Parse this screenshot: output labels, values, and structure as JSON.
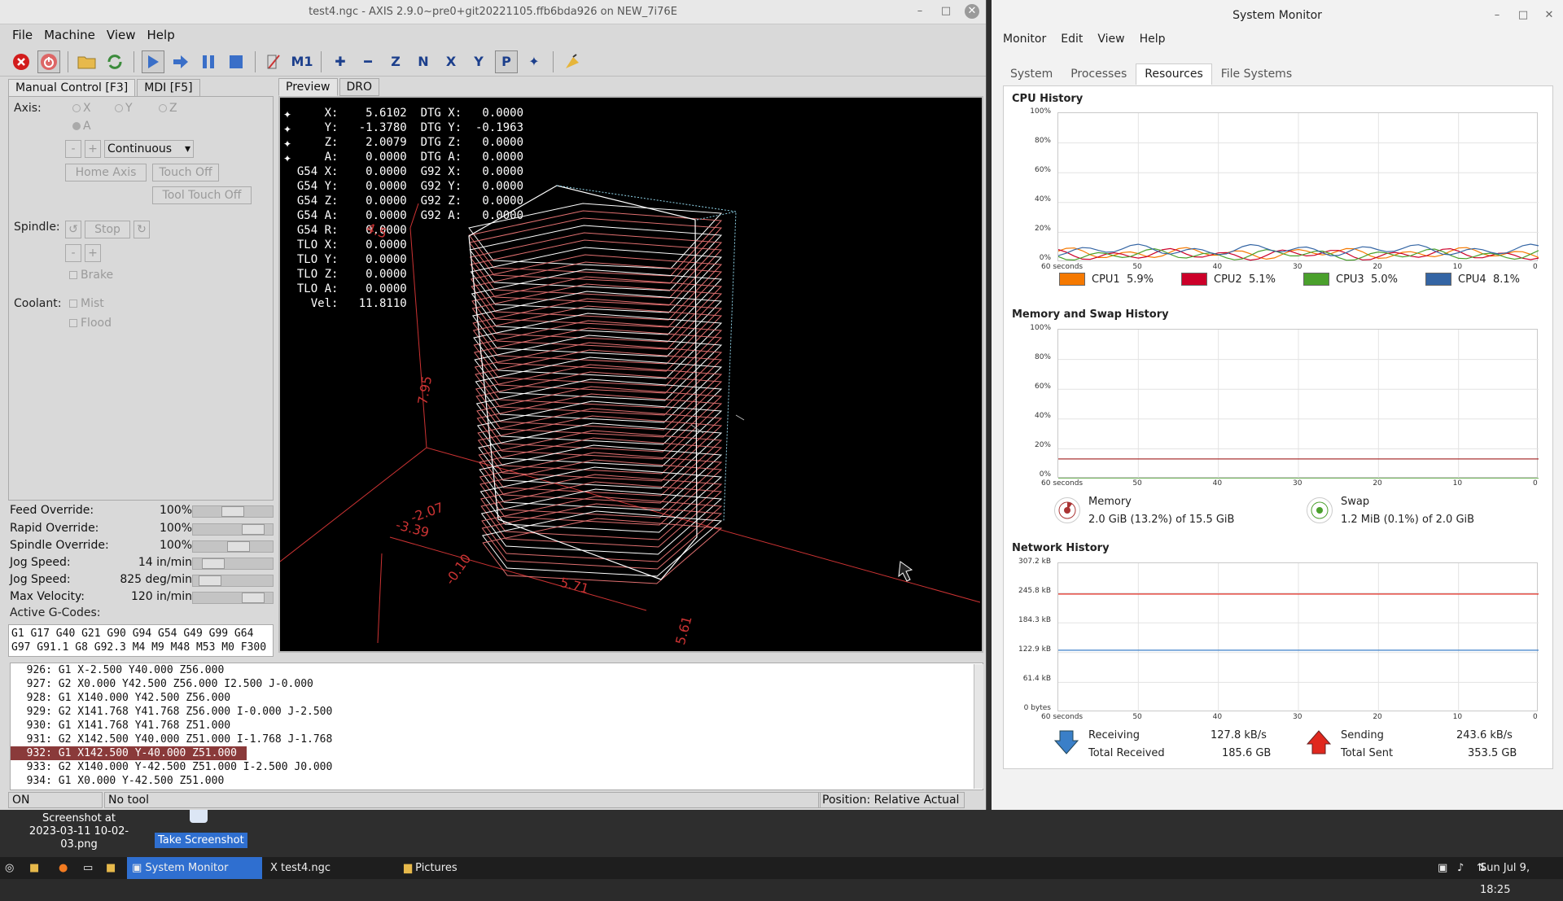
{
  "axis": {
    "title": "test4.ngc - AXIS 2.9.0~pre0+git20221105.ffb6bda926 on NEW_7i76E",
    "menu": [
      "File",
      "Machine",
      "View",
      "Help"
    ],
    "tabs": [
      "Manual Control [F3]",
      "MDI [F5]"
    ],
    "axis_label": "Axis:",
    "axes": [
      "X",
      "Y",
      "Z",
      "A"
    ],
    "jog_mode": "Continuous",
    "minus": "-",
    "plus": "+",
    "home_axis": "Home Axis",
    "touch_off": "Touch Off",
    "tool_touch_off": "Tool Touch Off",
    "spindle_label": "Spindle:",
    "stop": "Stop",
    "brake": "Brake",
    "coolant_label": "Coolant:",
    "mist": "Mist",
    "flood": "Flood",
    "overrides": [
      {
        "name": "Feed Override:",
        "value": "100%",
        "level": 0.5
      },
      {
        "name": "Rapid Override:",
        "value": "100%",
        "level": 0.85
      },
      {
        "name": "Spindle Override:",
        "value": "100%",
        "level": 0.6
      },
      {
        "name": "Jog Speed:",
        "value": "14 in/min",
        "level": 0.15
      },
      {
        "name": "Jog Speed:",
        "value": "825 deg/min",
        "level": 0.1
      },
      {
        "name": "Max Velocity:",
        "value": "120 in/min",
        "level": 0.85
      }
    ],
    "active_gcodes_label": "Active G-Codes:",
    "active_gcodes": "G1 G17 G40 G21 G90 G94 G54 G49 G99 G64\nG97 G91.1 G8 G92.3 M4 M9 M48 M53 M0 F300",
    "preview_tabs": [
      "Preview",
      "DRO"
    ],
    "dro_text": "      X:    5.6102  DTG X:   0.0000\n      Y:   -1.3780  DTG Y:  -0.1963\n      Z:    2.0079  DTG Z:   0.0000\n      A:    0.0000  DTG A:   0.0000\n  G54 X:    0.0000  G92 X:   0.0000\n  G54 Y:    0.0000  G92 Y:   0.0000\n  G54 Z:    0.0000  G92 Z:   0.0000\n  G54 A:    0.0000  G92 A:   0.0000\n  G54 R:    0.0000\n  TLO X:    0.0000\n  TLO Y:    0.0000\n  TLO Z:    0.0000\n  TLO A:    0.0000\n    Vel:   11.8110",
    "dims": [
      "7.95",
      "-2.07",
      "-3.39",
      "-0.10",
      "5.71",
      "5.61",
      "4.5"
    ],
    "code_lines": [
      "  926: G1 X-2.500 Y40.000 Z56.000",
      "  927: G2 X0.000 Y42.500 Z56.000 I2.500 J-0.000",
      "  928: G1 X140.000 Y42.500 Z56.000",
      "  929: G2 X141.768 Y41.768 Z56.000 I-0.000 J-2.500",
      "  930: G1 X141.768 Y41.768 Z51.000",
      "  931: G2 X142.500 Y40.000 Z51.000 I-1.768 J-1.768",
      "  932: G1 X142.500 Y-40.000 Z51.000",
      "  933: G2 X140.000 Y-42.500 Z51.000 I-2.500 J0.000",
      "  934: G1 X0.000 Y-42.500 Z51.000"
    ],
    "highlight_index": 6,
    "status_on": "ON",
    "status_tool": "No tool",
    "status_position": "Position: Relative Actual"
  },
  "sysmon": {
    "title": "System Monitor",
    "menu": [
      "Monitor",
      "Edit",
      "View",
      "Help"
    ],
    "tabs": [
      "System",
      "Processes",
      "Resources",
      "File Systems"
    ],
    "cpu_title": "CPU History",
    "pct_ticks": [
      "100%",
      "80%",
      "60%",
      "40%",
      "20%",
      "0%"
    ],
    "x_ticks": [
      "60 seconds",
      "50",
      "40",
      "30",
      "20",
      "10",
      "0"
    ],
    "cpus": [
      {
        "name": "CPU1",
        "value": "5.9%",
        "color": "#f57900"
      },
      {
        "name": "CPU2",
        "value": "5.1%",
        "color": "#cc0029"
      },
      {
        "name": "CPU3",
        "value": "5.0%",
        "color": "#4aa02c"
      },
      {
        "name": "CPU4",
        "value": "8.1%",
        "color": "#3465a4"
      }
    ],
    "mem_title": "Memory and Swap History",
    "memory_label": "Memory",
    "memory_value": "2.0 GiB (13.2%) of 15.5 GiB",
    "swap_label": "Swap",
    "swap_value": "1.2 MiB (0.1%) of 2.0 GiB",
    "net_title": "Network History",
    "net_ticks": [
      "307.2 kB",
      "245.8 kB",
      "184.3 kB",
      "122.9 kB",
      "61.4 kB",
      "0 bytes"
    ],
    "receiving_label": "Receiving",
    "receiving_value": "127.8 kB/s",
    "total_received_label": "Total Received",
    "total_received_value": "185.6 GB",
    "sending_label": "Sending",
    "sending_value": "243.6 kB/s",
    "total_sent_label": "Total Sent",
    "total_sent_value": "353.5 GB"
  },
  "desktop": {
    "thumb_label": "Screenshot at 2023-03-11 10-02-03.png",
    "take_screenshot": "Take Screenshot"
  },
  "taskbar": {
    "items": [
      "System Monitor",
      "test4.ngc",
      "Pictures"
    ],
    "clock": "Sun Jul 9, 18:25"
  }
}
